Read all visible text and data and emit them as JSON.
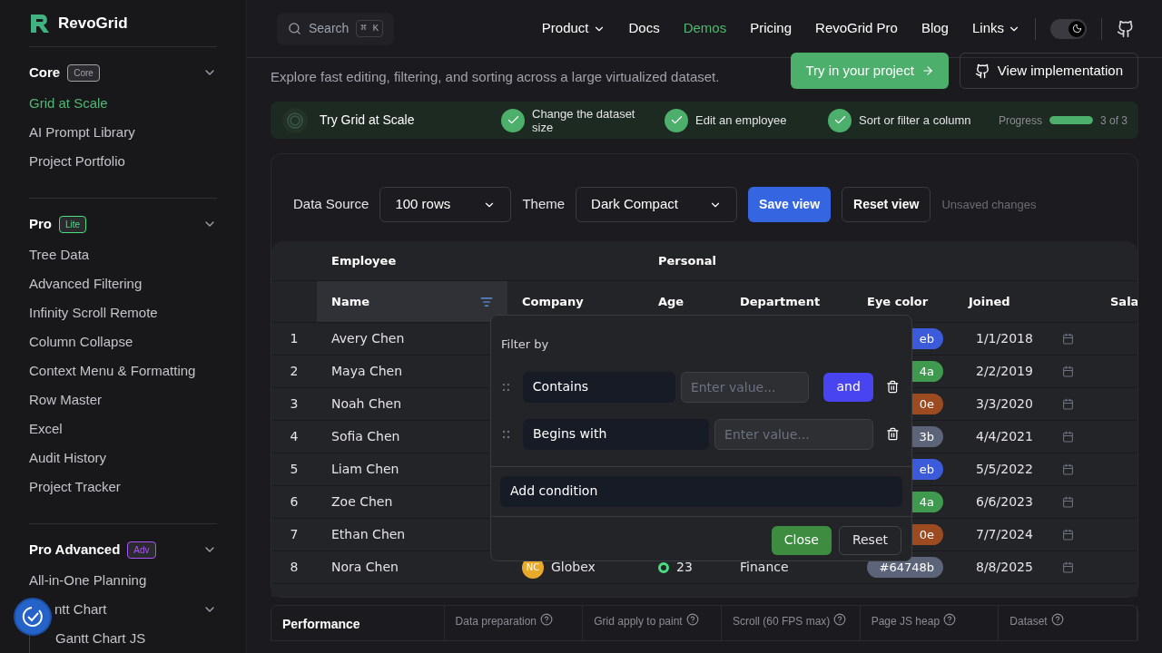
{
  "sidebar": {
    "logo": "RevoGrid",
    "sections": [
      {
        "title": "Core",
        "badge": {
          "text": "Core",
          "color": "#a1a1aa"
        },
        "items": [
          {
            "label": "Grid at Scale",
            "selected": true
          },
          {
            "label": "AI Prompt Library",
            "selected": false
          },
          {
            "label": "Project Portfolio",
            "selected": false
          }
        ]
      },
      {
        "title": "Pro",
        "badge": {
          "text": "Lite",
          "color": "#4ade80"
        },
        "items": [
          {
            "label": "Tree Data",
            "selected": false
          },
          {
            "label": "Advanced Filtering",
            "selected": false
          },
          {
            "label": "Infinity Scroll Remote",
            "selected": false
          },
          {
            "label": "Column Collapse",
            "selected": false
          },
          {
            "label": "Context Menu & Formatting",
            "selected": false
          },
          {
            "label": "Row Master",
            "selected": false
          },
          {
            "label": "Excel",
            "selected": false
          },
          {
            "label": "Audit History",
            "selected": false
          },
          {
            "label": "Project Tracker",
            "selected": false
          }
        ]
      },
      {
        "title": "Pro Advanced",
        "badge": {
          "text": "Adv",
          "color": "#a855f7"
        },
        "items": [
          {
            "label": "All-in-One Planning",
            "selected": false
          },
          {
            "label": "ntt Chart",
            "selected": false,
            "children": [
              {
                "label": "Gantt Chart JS",
                "selected": false
              }
            ]
          }
        ]
      }
    ]
  },
  "header": {
    "search": {
      "placeholder": "Search",
      "shortcut": "⌘ K"
    },
    "nav": [
      {
        "label": "Product",
        "kind": "menu",
        "selected": false
      },
      {
        "label": "Docs",
        "kind": "link",
        "selected": false
      },
      {
        "label": "Demos",
        "kind": "link",
        "selected": true
      },
      {
        "label": "Pricing",
        "kind": "link",
        "selected": false
      },
      {
        "label": "RevoGrid Pro",
        "kind": "link",
        "selected": false
      },
      {
        "label": "Blog",
        "kind": "link",
        "selected": false
      },
      {
        "label": "Links",
        "kind": "menu",
        "selected": false
      }
    ],
    "dark_mode": {
      "on": true
    }
  },
  "intro": {
    "text": "Explore fast editing, filtering, and sorting across a large virtualized dataset.",
    "primary_button": "Try in your project",
    "secondary_button": "View implementation"
  },
  "steps": {
    "title": "Try Grid at Scale",
    "items": [
      {
        "label": "Change the dataset size",
        "done": true
      },
      {
        "label": "Edit an employee",
        "done": true
      },
      {
        "label": "Sort or filter a column",
        "done": true
      }
    ],
    "progress_label": "Progress",
    "level": 1,
    "reading": "3 of 3"
  },
  "toolbar": {
    "data_source": {
      "label": "Data Source",
      "value": "100 rows"
    },
    "theme": {
      "label": "Theme",
      "value": "Dark Compact"
    },
    "save_button": "Save view",
    "reset_button": "Reset view",
    "status": "Unsaved changes"
  },
  "table": {
    "groups": [
      "Employee",
      "Personal"
    ],
    "columns": [
      {
        "label": "Name",
        "filtered": true
      },
      {
        "label": "Company",
        "filtered": false
      },
      {
        "label": "Age",
        "filtered": false
      },
      {
        "label": "Department",
        "filtered": false
      },
      {
        "label": "Eye color",
        "filtered": false
      },
      {
        "label": "Joined",
        "filtered": false
      },
      {
        "label": "Sala",
        "filtered": false
      }
    ],
    "rows": [
      {
        "num": "1",
        "name": "Avery Chen",
        "eye_color": {
          "text": "eb",
          "color": "#3b5bdb"
        },
        "joined": "1/1/2018"
      },
      {
        "num": "2",
        "name": "Maya Chen",
        "eye_color": {
          "text": "4a",
          "color": "#3f9a4f"
        },
        "joined": "2/2/2019"
      },
      {
        "num": "3",
        "name": "Noah Chen",
        "eye_color": {
          "text": "0e",
          "color": "#9c4a1f"
        },
        "joined": "3/3/2020"
      },
      {
        "num": "4",
        "name": "Sofia Chen",
        "eye_color": {
          "text": "3b",
          "color": "#5b6478"
        },
        "joined": "4/4/2021"
      },
      {
        "num": "5",
        "name": "Liam Chen",
        "eye_color": {
          "text": "eb",
          "color": "#3b5bdb"
        },
        "joined": "5/5/2022"
      },
      {
        "num": "6",
        "name": "Zoe Chen",
        "eye_color": {
          "text": "4a",
          "color": "#3f9a4f"
        },
        "joined": "6/6/2023"
      },
      {
        "num": "7",
        "name": "Ethan Chen",
        "eye_color": {
          "text": "0e",
          "color": "#9c4a1f"
        },
        "joined": "7/7/2024"
      },
      {
        "num": "8",
        "name": "Nora Chen",
        "company": {
          "initials": "NC",
          "name": "Globex",
          "color": "#e9a92a"
        },
        "age": {
          "text": "23",
          "color": "#4ade80"
        },
        "department": "Finance",
        "eye_color": {
          "text": "#64748b",
          "color": "#5b6478"
        },
        "joined": "8/8/2025"
      }
    ]
  },
  "filter": {
    "title": "Filter by",
    "conditions": [
      {
        "operator": "Contains",
        "placeholder": "Enter value...",
        "join": "and"
      },
      {
        "operator": "Begins with",
        "placeholder": "Enter value..."
      }
    ],
    "add_button": "Add condition",
    "close_button": "Close",
    "reset_button": "Reset"
  },
  "performance": {
    "title": "Performance",
    "metrics": [
      "Data preparation",
      "Grid apply to paint",
      "Scroll (60 FPS max)",
      "Page JS heap",
      "Dataset"
    ]
  }
}
